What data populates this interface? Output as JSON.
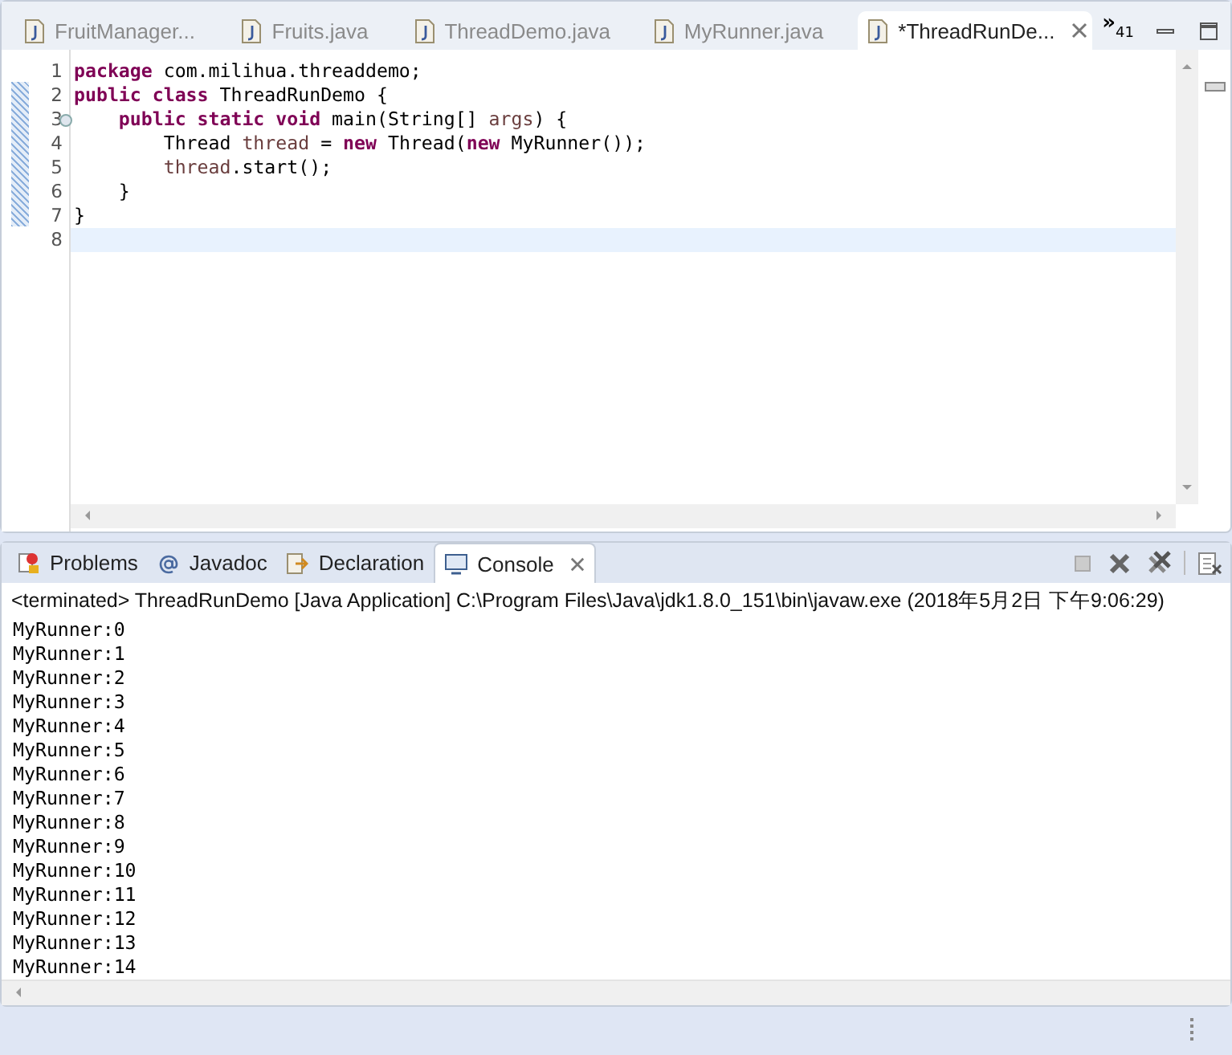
{
  "editor_tabs": [
    {
      "label": "FruitManager...",
      "selected": false
    },
    {
      "label": "Fruits.java",
      "selected": false
    },
    {
      "label": "ThreadDemo.java",
      "selected": false
    },
    {
      "label": "MyRunner.java",
      "selected": false
    },
    {
      "label": "*ThreadRunDe...",
      "selected": true
    }
  ],
  "overflow": {
    "symbol": "»",
    "count": "41"
  },
  "code_lines": [
    {
      "number": "1",
      "foldable": false,
      "current": false,
      "tokens": [
        {
          "kind": "keyword",
          "text": "package"
        },
        {
          "kind": "plain",
          "text": " com.milihua.threaddemo;"
        }
      ]
    },
    {
      "number": "2",
      "foldable": false,
      "current": false,
      "tokens": [
        {
          "kind": "keyword",
          "text": "public class"
        },
        {
          "kind": "plain",
          "text": " ThreadRunDemo {"
        }
      ]
    },
    {
      "number": "3",
      "foldable": true,
      "current": false,
      "tokens": [
        {
          "kind": "keyword",
          "text": "    public static void"
        },
        {
          "kind": "plain",
          "text": " main(String[] "
        },
        {
          "kind": "variable",
          "text": "args"
        },
        {
          "kind": "plain",
          "text": ") {"
        }
      ]
    },
    {
      "number": "4",
      "foldable": false,
      "current": false,
      "tokens": [
        {
          "kind": "plain",
          "text": "        Thread "
        },
        {
          "kind": "variable",
          "text": "thread"
        },
        {
          "kind": "plain",
          "text": " = "
        },
        {
          "kind": "keyword",
          "text": "new"
        },
        {
          "kind": "plain",
          "text": " Thread("
        },
        {
          "kind": "keyword",
          "text": "new"
        },
        {
          "kind": "plain",
          "text": " MyRunner());"
        }
      ]
    },
    {
      "number": "5",
      "foldable": false,
      "current": false,
      "tokens": [
        {
          "kind": "variable",
          "text": "        thread"
        },
        {
          "kind": "plain",
          "text": ".start();"
        }
      ]
    },
    {
      "number": "6",
      "foldable": false,
      "current": false,
      "tokens": [
        {
          "kind": "plain",
          "text": "    }"
        }
      ]
    },
    {
      "number": "7",
      "foldable": false,
      "current": false,
      "tokens": [
        {
          "kind": "plain",
          "text": "}"
        }
      ]
    },
    {
      "number": "8",
      "foldable": false,
      "current": true
    }
  ],
  "view_tabs": [
    {
      "kind": "problems",
      "label": "Problems",
      "selected": false
    },
    {
      "kind": "javadoc",
      "label": "Javadoc",
      "selected": false
    },
    {
      "kind": "declaration",
      "label": "Declaration",
      "selected": false
    },
    {
      "kind": "console",
      "label": "Console",
      "selected": true
    }
  ],
  "console": {
    "header": "<terminated> ThreadRunDemo [Java Application] C:\\Program Files\\Java\\jdk1.8.0_151\\bin\\javaw.exe (2018年5月2日 下午9:06:29)",
    "lines": [
      "MyRunner:0",
      "MyRunner:1",
      "MyRunner:2",
      "MyRunner:3",
      "MyRunner:4",
      "MyRunner:5",
      "MyRunner:6",
      "MyRunner:7",
      "MyRunner:8",
      "MyRunner:9",
      "MyRunner:10",
      "MyRunner:11",
      "MyRunner:12",
      "MyRunner:13",
      "MyRunner:14"
    ]
  }
}
